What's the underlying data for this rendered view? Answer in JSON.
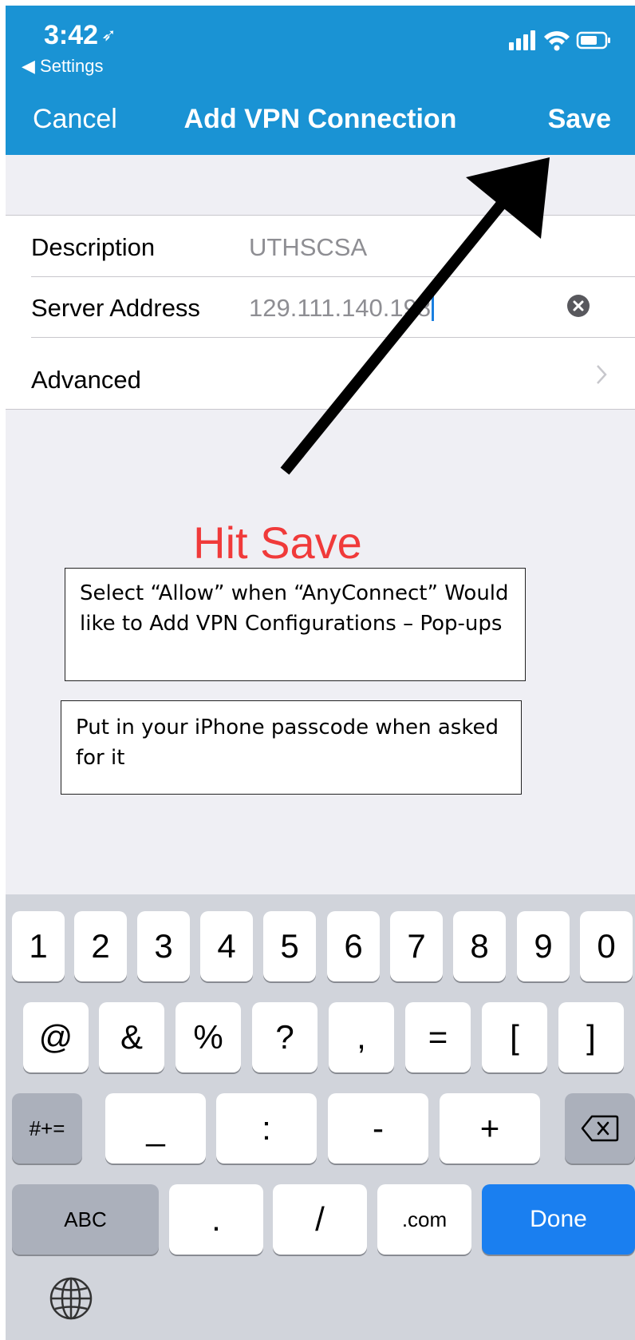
{
  "status_bar": {
    "time": "3:42",
    "back_label": "Settings"
  },
  "nav": {
    "cancel": "Cancel",
    "title": "Add VPN Connection",
    "save": "Save"
  },
  "form": {
    "rows": [
      {
        "label": "Description",
        "value": "UTHSCSA"
      },
      {
        "label": "Server Address",
        "value": "129.111.140.198"
      },
      {
        "label": "Advanced"
      }
    ]
  },
  "annotations": {
    "hit_save": "Hit Save",
    "note1": "Select “Allow” when “AnyConnect” Would like to Add VPN Configurations – Pop-ups",
    "note2": "Put in your iPhone passcode when asked for it"
  },
  "keyboard": {
    "row1": [
      "1",
      "2",
      "3",
      "4",
      "5",
      "6",
      "7",
      "8",
      "9",
      "0"
    ],
    "row2": [
      "@",
      "&",
      "%",
      "?",
      ",",
      "=",
      "[",
      "]"
    ],
    "row3": [
      "#+=",
      "_",
      ":",
      "-",
      "+"
    ],
    "row4": [
      "ABC",
      ".",
      "/",
      ".com",
      "Done"
    ]
  },
  "colors": {
    "nav_bar": "#1a93d4",
    "annotation_red": "#f03a3a",
    "done_key": "#1a7ff0"
  }
}
